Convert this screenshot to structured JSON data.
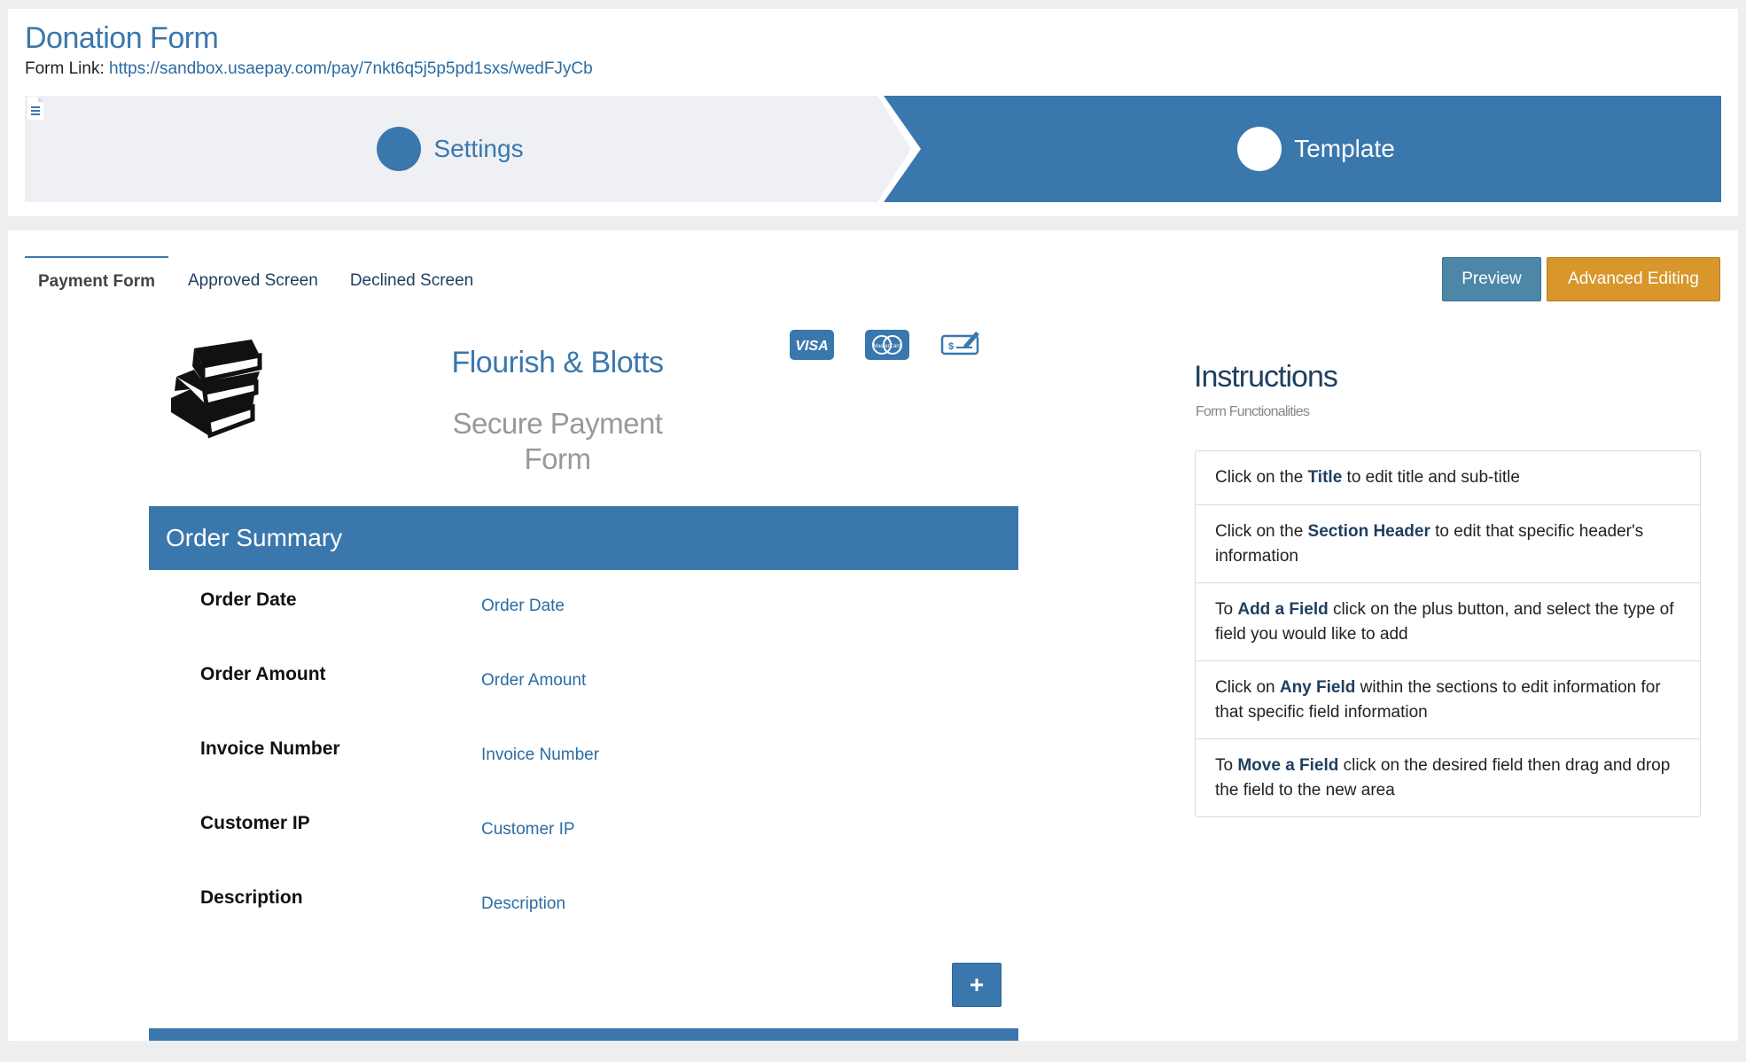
{
  "header": {
    "title": "Donation Form",
    "link_label": "Form Link:",
    "link_url": "https://sandbox.usaepay.com/pay/7nkt6q5j5p5pd1sxs/wedFJyCb"
  },
  "wizard": {
    "steps": [
      {
        "label": "Settings",
        "icon": "document-icon",
        "active": false
      },
      {
        "label": "Template",
        "icon": "grid-icon",
        "active": true
      }
    ],
    "colors": {
      "inactive_bg": "#eef0f4",
      "active_bg": "#3a77ad"
    }
  },
  "tabs": [
    {
      "label": "Payment Form",
      "active": true
    },
    {
      "label": "Approved Screen",
      "active": false
    },
    {
      "label": "Declined Screen",
      "active": false
    }
  ],
  "actions": {
    "preview_label": "Preview",
    "advanced_label": "Advanced Editing",
    "preview_color": "#4c87a8",
    "advanced_color": "#d8962b"
  },
  "form": {
    "logo_icon": "books-icon",
    "merchant_name": "Flourish & Blotts",
    "subtitle_line1": "Secure Payment",
    "subtitle_line2": "Form",
    "card_icons": [
      "visa-icon",
      "mastercard-icon",
      "check-icon"
    ],
    "card_texts": {
      "visa": "VISA",
      "mastercard": "MasterCard"
    },
    "section_title": "Order Summary",
    "fields": [
      {
        "label": "Order Date",
        "value": "Order Date"
      },
      {
        "label": "Order Amount",
        "value": "Order Amount"
      },
      {
        "label": "Invoice Number",
        "value": "Invoice Number"
      },
      {
        "label": "Customer IP",
        "value": "Customer IP"
      },
      {
        "label": "Description",
        "value": "Description"
      }
    ],
    "add_button_glyph": "+"
  },
  "instructions": {
    "title": "Instructions",
    "subtitle": "Form Functionalities",
    "items": [
      {
        "pre": "Click on the ",
        "bold": "Title",
        "post": " to edit title and sub-title"
      },
      {
        "pre": "Click on the ",
        "bold": "Section Header",
        "post": " to edit that specific header's information"
      },
      {
        "pre": "To ",
        "bold": "Add a Field",
        "post": " click on the plus button, and select the type of field you would like to add"
      },
      {
        "pre": "Click on ",
        "bold": "Any Field",
        "post": " within the sections to edit information for that specific field information"
      },
      {
        "pre": "To ",
        "bold": "Move a Field",
        "post": " click on the desired field then drag and drop the field to the new area"
      }
    ]
  }
}
